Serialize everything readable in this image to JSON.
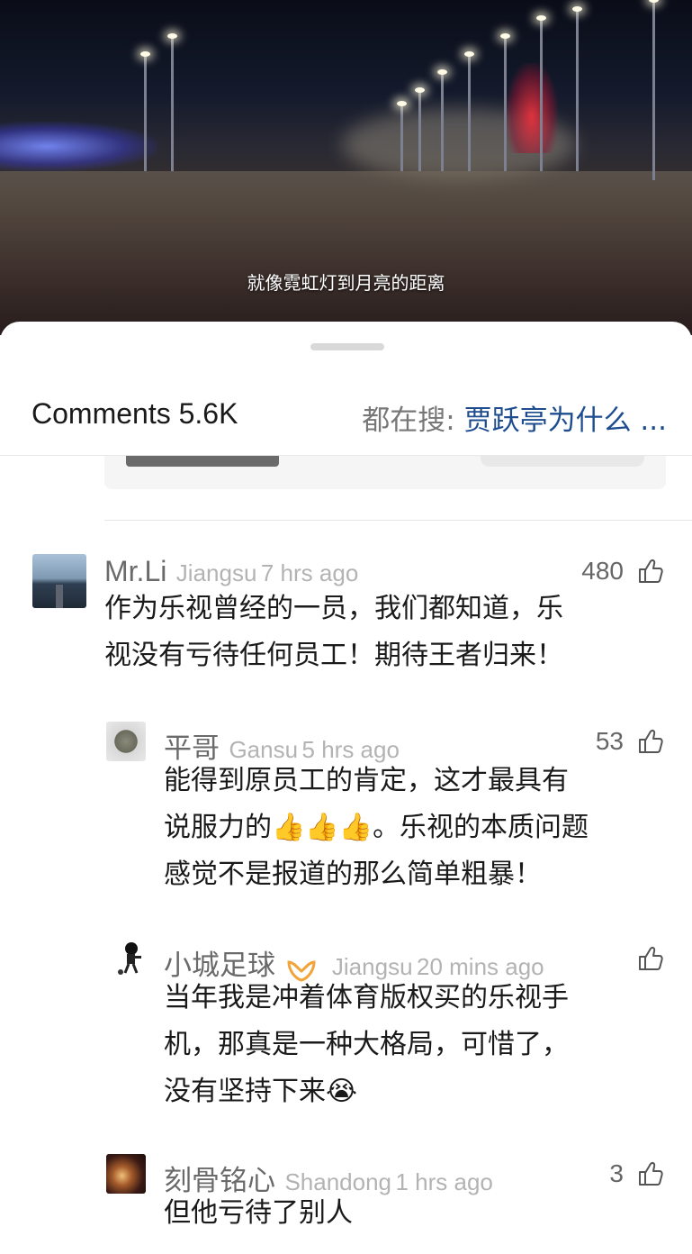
{
  "video": {
    "subtitle": "就像霓虹灯到月亮的距离"
  },
  "header": {
    "comments_label": "Comments",
    "comments_count": "5.6K",
    "search_prefix": "都在搜:",
    "search_term": "贾跃亭为什么 ..."
  },
  "comments": [
    {
      "name": "Mr.Li",
      "location": "Jiangsu",
      "time": "7 hrs ago",
      "likes": "480",
      "text_line1": "作为乐视曾经的一员，我们都知道，乐",
      "text_line2": "视没有亏待任何员工！期待王者归来！"
    },
    {
      "name": "平哥",
      "location": "Gansu",
      "time": "5 hrs ago",
      "likes": "53",
      "text_line1": "能得到原员工的肯定，这才最具有",
      "text_line2_a": "说服力的",
      "emoji_thumbs": "👍👍👍",
      "text_line2_b": "。乐视的本质问题",
      "text_line3": "感觉不是报道的那么简单粗暴！"
    },
    {
      "name": "小城足球",
      "location": "Jiangsu",
      "time": "20 mins ago",
      "likes": "",
      "text_line1": "当年我是冲着体育版权买的乐视手",
      "text_line2": "机，那真是一种大格局，可惜了，",
      "text_line3": "没有坚持下来",
      "emoji_cry": "😭"
    },
    {
      "name": "刻骨铭心",
      "location": "Shandong",
      "time": "1 hrs ago",
      "likes": "3",
      "text_line1": "但他亏待了别人"
    }
  ],
  "colors": {
    "link_blue": "#1d4c8f",
    "vip_orange": "#f2a33a"
  },
  "icons": [
    "thumbs-up-icon",
    "vip-badge-icon"
  ]
}
